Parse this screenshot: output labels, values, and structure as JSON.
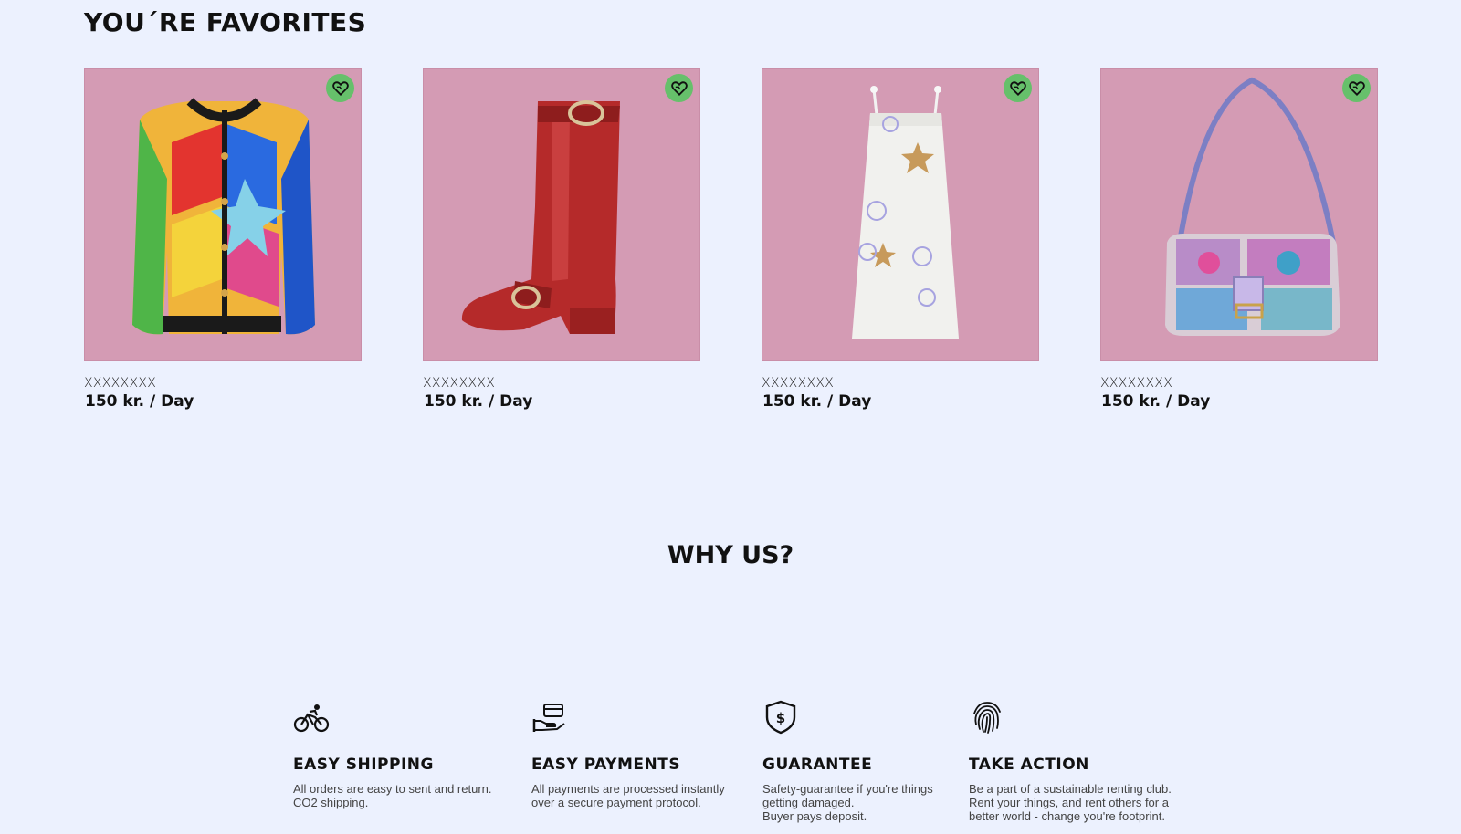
{
  "favorites": {
    "title": "YOU´RE FAVORITES",
    "products": [
      {
        "name": "XXXXXXXX",
        "price": "150 kr. / Day",
        "image": "colorful-quilted-jacket",
        "fav_icon": "heart-icon"
      },
      {
        "name": "XXXXXXXX",
        "price": "150 kr. / Day",
        "image": "red-leather-boot",
        "fav_icon": "heart-icon"
      },
      {
        "name": "XXXXXXXX",
        "price": "150 kr. / Day",
        "image": "white-sequin-dress",
        "fav_icon": "heart-icon"
      },
      {
        "name": "XXXXXXXX",
        "price": "150 kr. / Day",
        "image": "beaded-shoulder-bag",
        "fav_icon": "heart-icon"
      }
    ]
  },
  "why_us": {
    "title": "WHY US?",
    "features": [
      {
        "icon": "bicycle-icon",
        "title": "EASY SHIPPING",
        "text": "All orders are easy to sent and return.\nCO2 shipping."
      },
      {
        "icon": "hand-payment-icon",
        "title": "EASY PAYMENTS",
        "text": "All payments are processed instantly\nover a secure payment protocol."
      },
      {
        "icon": "shield-dollar-icon",
        "title": "GUARANTEE",
        "text": "Safety-guarantee if you're things\ngetting damaged.\nBuyer pays deposit."
      },
      {
        "icon": "fingerprint-icon",
        "title": "TAKE ACTION",
        "text": "Be a part of a sustainable renting club.\nRent your things, and rent others for a\nbetter world - change you're footprint."
      }
    ]
  },
  "colors": {
    "background": "#ecf1fe",
    "card_background": "#d49bb4",
    "favorite_button": "#66c06b",
    "text": "#111111"
  }
}
